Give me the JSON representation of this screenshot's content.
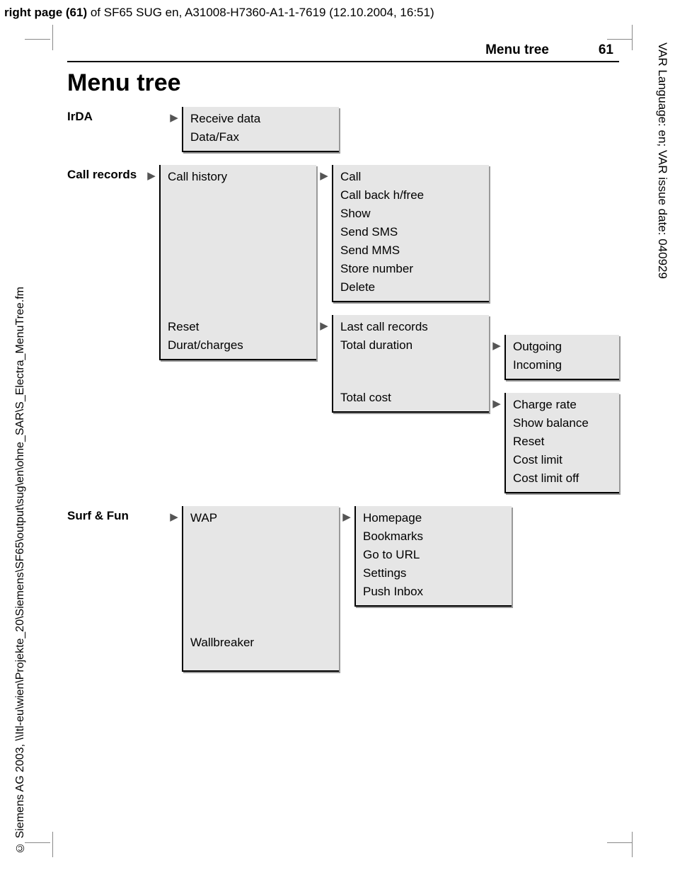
{
  "top_header": {
    "prefix": "right page (61)",
    "rest": " of SF65 SUG en, A31008-H7360-A1-1-7619 (12.10.2004, 16:51)"
  },
  "right_vertical": "VAR Language: en; VAR issue date: 040929",
  "left_vertical": "© Siemens AG 2003, \\\\Itl-eu\\wien\\Projekte_20\\Siemens\\SF65\\output\\sug\\en\\ohne_SAR\\S_Electra_MenuTree.fm",
  "page_header": {
    "title": "Menu tree",
    "number": "61"
  },
  "h1": "Menu tree",
  "arrow_glyph": "▶",
  "irda": {
    "label": "IrDA",
    "items": [
      "Receive data",
      "Data/Fax"
    ]
  },
  "call_records": {
    "label": "Call records",
    "col2": {
      "group1_first": "Call history",
      "group1_rest": [
        "Reset",
        "Durat/charges"
      ]
    },
    "call_history_sub": [
      "Call",
      "Call back h/free",
      "Show",
      "Send SMS",
      "Send MMS",
      "Store number",
      "Delete"
    ],
    "durat_sub": {
      "a": "Last call records",
      "b": "Total duration",
      "c": "Total cost"
    },
    "total_duration_sub": [
      "Outgoing",
      "Incoming"
    ],
    "total_cost_sub": [
      "Charge rate",
      "Show balance",
      "Reset",
      "Cost limit",
      "Cost limit off"
    ]
  },
  "surf_fun": {
    "label": "Surf & Fun",
    "col2_a": "WAP",
    "col2_b": "Wallbreaker",
    "wap_sub": [
      "Homepage",
      "Bookmarks",
      "Go to URL",
      "Settings",
      "Push Inbox"
    ]
  }
}
